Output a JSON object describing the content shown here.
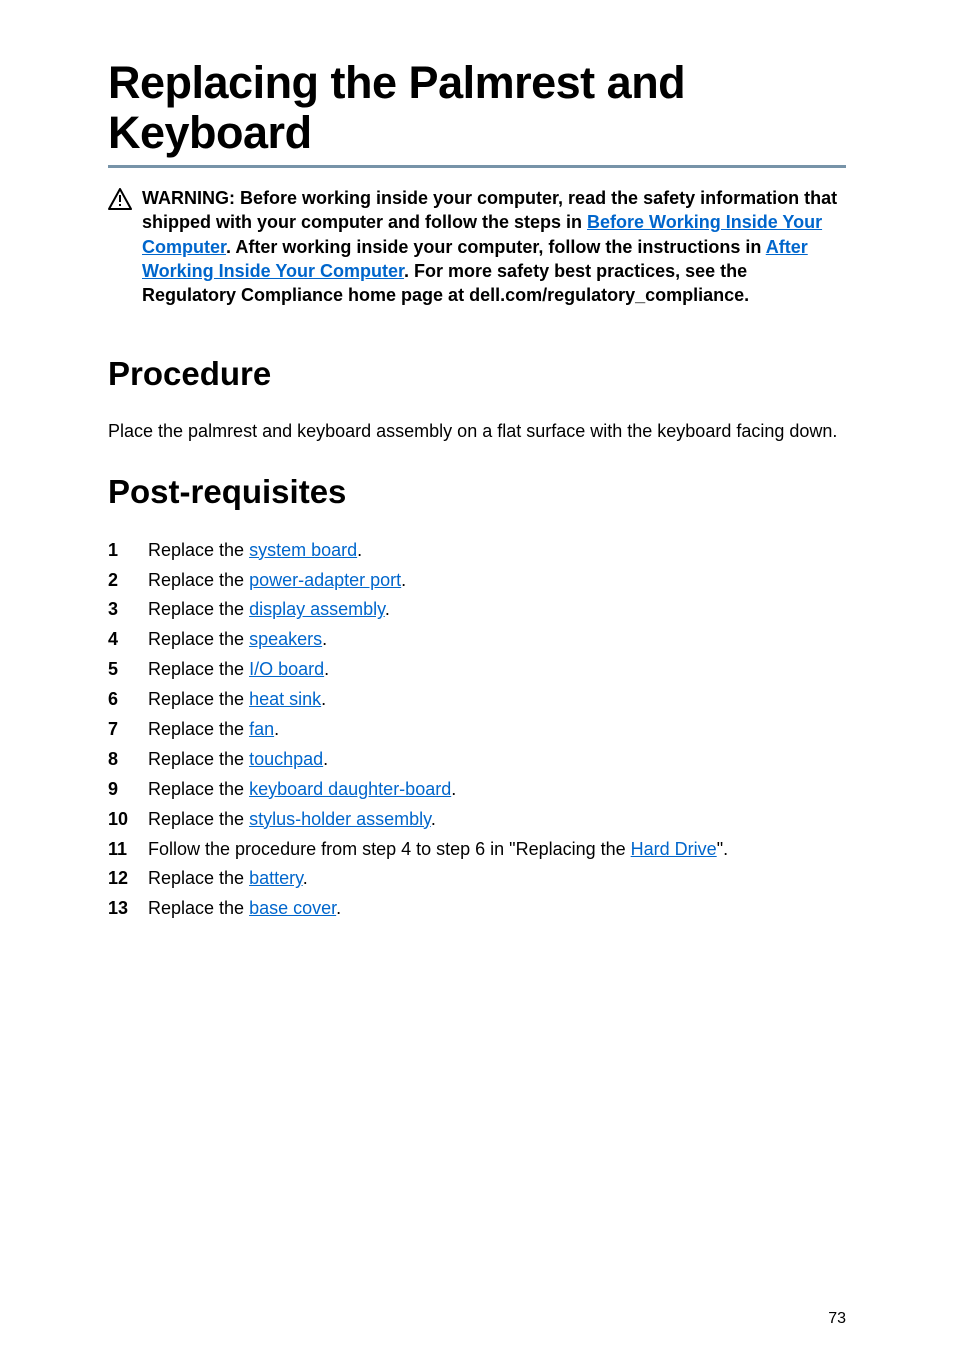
{
  "title": "Replacing the Palmrest and Keyboard",
  "warning": {
    "prefix": "WARNING: Before working inside your computer, read the safety information that shipped with your computer and follow the steps in ",
    "link1": "Before Working Inside Your Computer",
    "mid1": ". After working inside your computer, follow the instructions in ",
    "link2": "After Working Inside Your Computer",
    "suffix": ". For more safety best practices, see the Regulatory Compliance home page at dell.com/regulatory_compliance."
  },
  "procedure": {
    "heading": "Procedure",
    "body": "Place the palmrest and keyboard assembly on a flat surface with the keyboard facing down."
  },
  "postreq": {
    "heading": "Post-requisites",
    "steps": [
      {
        "pre": "Replace the ",
        "link": "system board",
        "post": "."
      },
      {
        "pre": "Replace the ",
        "link": "power-adapter port",
        "post": "."
      },
      {
        "pre": "Replace the ",
        "link": "display assembly",
        "post": "."
      },
      {
        "pre": "Replace the ",
        "link": "speakers",
        "post": "."
      },
      {
        "pre": "Replace the ",
        "link": "I/O board",
        "post": "."
      },
      {
        "pre": "Replace the ",
        "link": "heat sink",
        "post": "."
      },
      {
        "pre": "Replace the ",
        "link": "fan",
        "post": "."
      },
      {
        "pre": "Replace the ",
        "link": "touchpad",
        "post": "."
      },
      {
        "pre": "Replace the ",
        "link": "keyboard daughter-board",
        "post": "."
      },
      {
        "pre": "Replace the ",
        "link": "stylus-holder assembly",
        "post": "."
      },
      {
        "pre": "Follow the procedure from step 4 to step 6 in \"Replacing the ",
        "link": "Hard Drive",
        "post": "\"."
      },
      {
        "pre": "Replace the ",
        "link": "battery",
        "post": "."
      },
      {
        "pre": "Replace the ",
        "link": "base cover",
        "post": "."
      }
    ]
  },
  "page_number": "73"
}
